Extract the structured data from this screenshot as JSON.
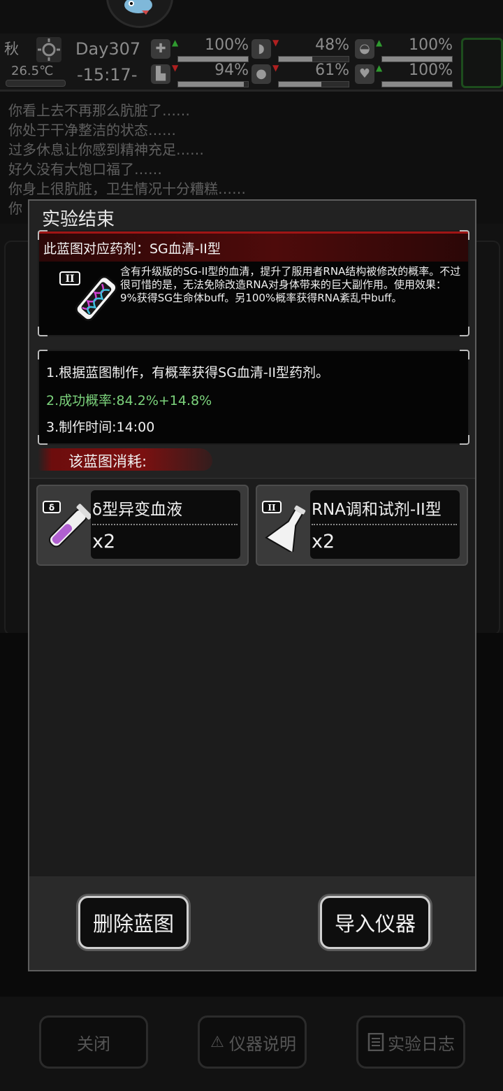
{
  "hud": {
    "season": "秋",
    "temperature": "26.5℃",
    "day": "Day307",
    "time": "-15:17-",
    "stats": [
      {
        "icon": "medkit-icon",
        "glyph": "✚",
        "trend": "up",
        "value": "100%",
        "level": 1.0
      },
      {
        "icon": "stomach-icon",
        "glyph": "◗",
        "trend": "down",
        "value": "48%",
        "level": 0.48
      },
      {
        "icon": "toilet-icon",
        "glyph": "◒",
        "trend": "up",
        "value": "100%",
        "level": 1.0
      },
      {
        "icon": "boot-icon",
        "glyph": "▙",
        "trend": "down",
        "value": "94%",
        "level": 0.94
      },
      {
        "icon": "water-drop-icon",
        "glyph": "●",
        "trend": "down",
        "value": "61%",
        "level": 0.61
      },
      {
        "icon": "heart-icon",
        "glyph": "♥",
        "trend": "up",
        "value": "100%",
        "level": 1.0
      }
    ]
  },
  "log": {
    "lines": [
      "你看上去不再那么肮脏了……",
      "你处于干净整洁的状态……",
      "过多休息让你感到精神充足……",
      "好久没有大饱口福了……",
      "你身上很肮脏，卫生情况十分糟糕……",
      "你"
    ]
  },
  "modal": {
    "title": "实验结束",
    "blueprint_header": "此蓝图对应药剂：SG血清-II型",
    "blueprint_desc": "含有升级版的SG-II型的血清，提升了服用者RNA结构被修改的概率。不过很可惜的是，无法免除改造RNA对身体带来的巨大副作用。使用效果：9%获得SG生命体buff。另100%概率获得RNA紊乱中buff。",
    "details": [
      "1.根据蓝图制作，有概率获得SG血清-II型药剂。",
      "2.成功概率:84.2%+14.8%",
      "3.制作时间:14:00"
    ],
    "consume_label": "该蓝图消耗:",
    "items": [
      {
        "name": "δ型异变血液",
        "qty": "x2",
        "icon": "blood-vial-icon"
      },
      {
        "name": "RNA调和试剂-II型",
        "qty": "x2",
        "icon": "flask-icon"
      }
    ],
    "delete_label": "删除蓝图",
    "import_label": "导入仪器"
  },
  "bottom": {
    "close_label": "关闭",
    "manual_label": "仪器说明",
    "log_label": "实验日志"
  },
  "colors": {
    "accent_red": "#a01515",
    "success_green": "#7cd37c",
    "panel": "#222222"
  }
}
